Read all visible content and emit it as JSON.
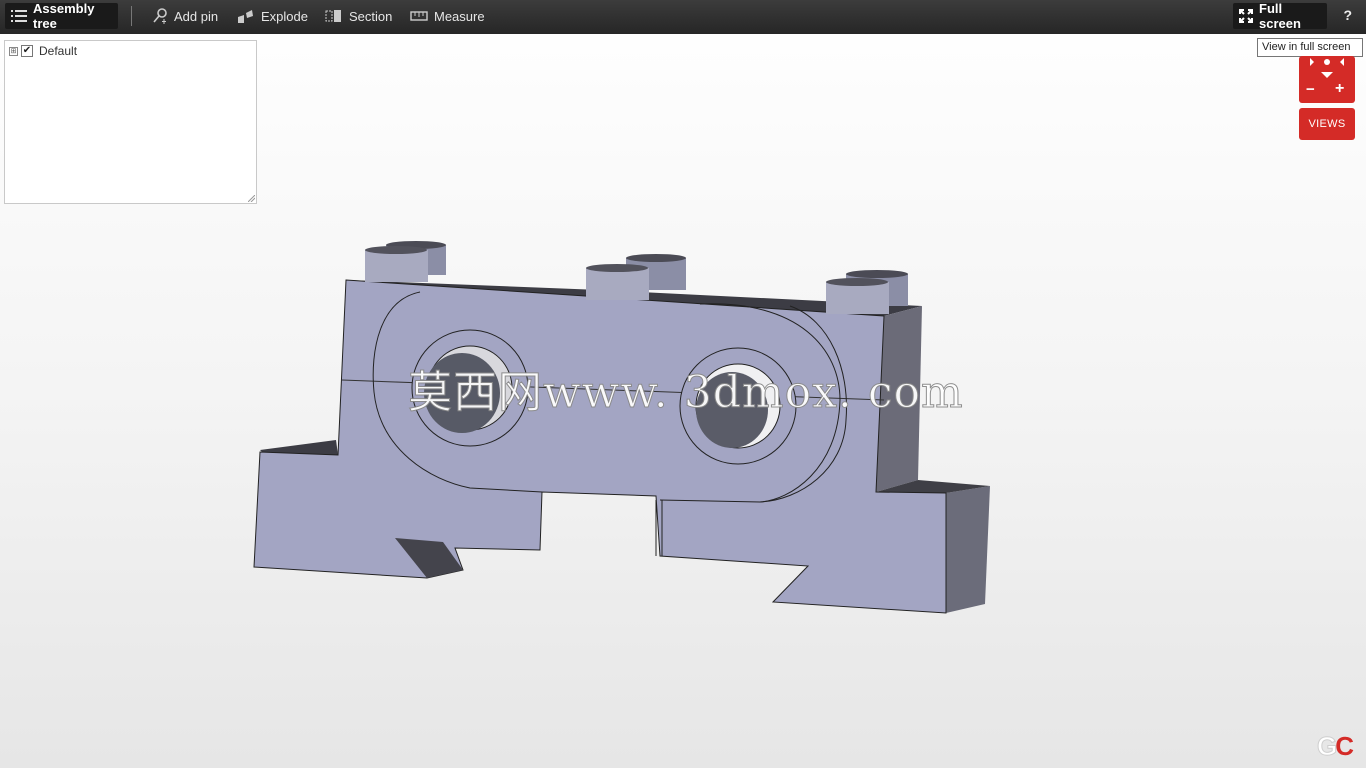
{
  "toolbar": {
    "assembly_tree": "Assembly tree",
    "add_pin": "Add pin",
    "explode": "Explode",
    "section": "Section",
    "measure": "Measure",
    "full_screen": "Full screen",
    "help": "?"
  },
  "tree": {
    "items": [
      {
        "label": "Default",
        "checked": true,
        "expander": "⊞"
      }
    ]
  },
  "tooltip": "View in full screen",
  "nav": {
    "views": "VIEWS",
    "zoom_out": "−",
    "zoom_in": "+"
  },
  "watermark": "莫西网www. 3dmox. com",
  "logo": {
    "g": "G",
    "c": "C"
  },
  "colors": {
    "toolbar_bg": "#2e2e2e",
    "accent_red": "#d42b27",
    "model_face": "#a2a4c1",
    "model_dark": "#3f3f46"
  },
  "icons": [
    "list-icon",
    "pin-icon",
    "explode-icon",
    "section-icon",
    "ruler-icon",
    "fullscreen-icon"
  ]
}
